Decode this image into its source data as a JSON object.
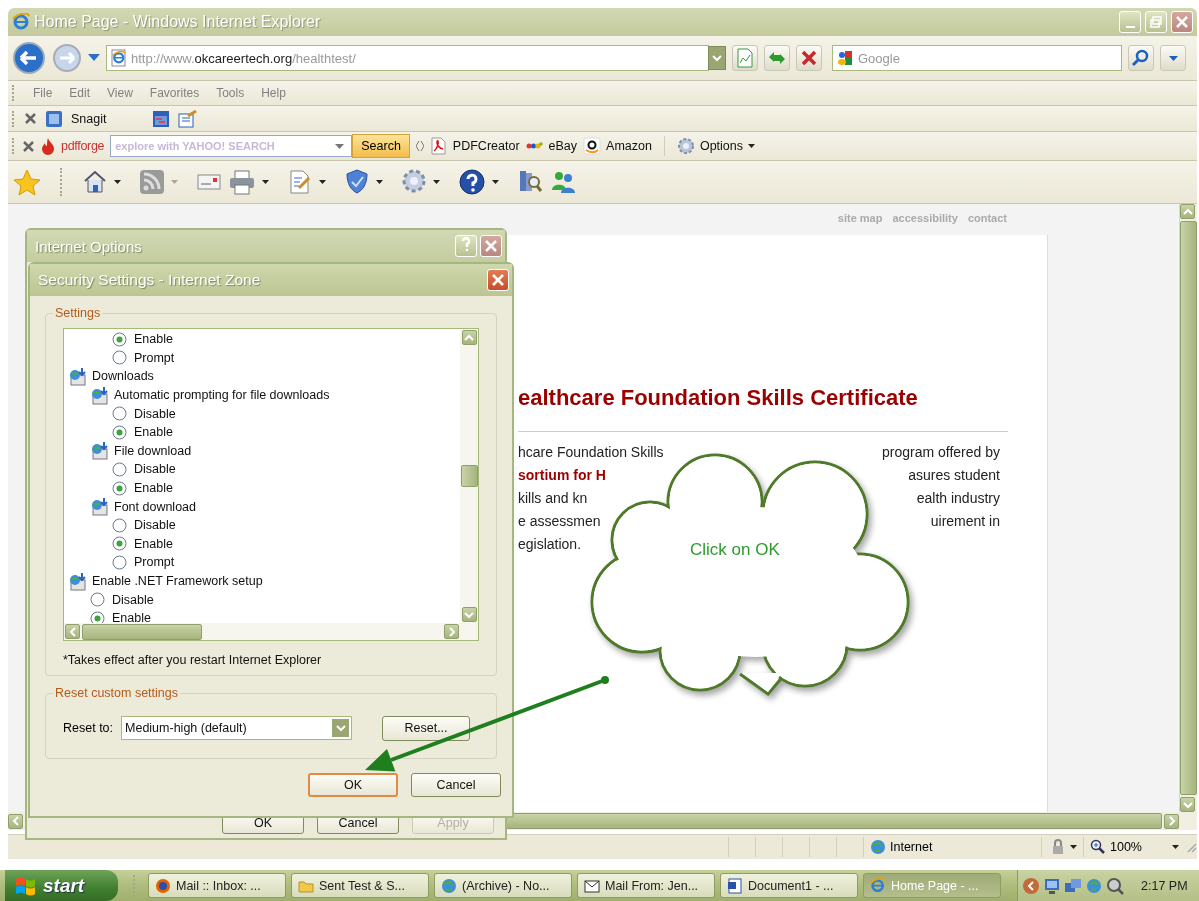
{
  "window": {
    "title": "Home Page - Windows Internet Explorer"
  },
  "address_bar": {
    "url": [
      "http://www.",
      "okcareertech.org",
      "/healthtest/"
    ],
    "search_placeholder": "Google"
  },
  "menu": [
    "File",
    "Edit",
    "View",
    "Favorites",
    "Tools",
    "Help"
  ],
  "snagit_toolbar": {
    "label": "Snagit"
  },
  "pdfforge_toolbar": {
    "logo": "pdfforge",
    "search_placeholder": "explore with YAHOO! SEARCH",
    "search_button": "Search",
    "links": [
      {
        "kind": "pdf",
        "label": "PDFCreator"
      },
      {
        "kind": "ebay",
        "label": "eBay"
      },
      {
        "kind": "amazon",
        "label": "Amazon"
      }
    ],
    "options": "Options"
  },
  "content": {
    "top_links": [
      "site map",
      "accessibility",
      "contact"
    ],
    "heading": "ealthcare Foundation Skills Certificate",
    "lines": [
      {
        "left": "hcare Foundation Skills",
        "right": "program offered by",
        "emphasis": false
      },
      {
        "left": "sortium for H",
        "right": "asures student",
        "emphasis": true
      },
      {
        "left": "kills and kn",
        "right": "ealth industry",
        "emphasis": false
      },
      {
        "left": "e assessmen",
        "right": "uirement in",
        "emphasis": false
      },
      {
        "left": "egislation.",
        "emphasis": false
      }
    ]
  },
  "callout": {
    "text": "Click on OK"
  },
  "internet_options": {
    "title": "Internet Options",
    "buttons": [
      {
        "label": "OK",
        "disabled": false
      },
      {
        "label": "Cancel",
        "disabled": false
      },
      {
        "label": "Apply",
        "disabled": true
      }
    ]
  },
  "security_dialog": {
    "title": "Security Settings - Internet Zone",
    "settings_label": "Settings",
    "tree": [
      {
        "kind": "group",
        "children": [
          {
            "kind": "group",
            "children": [
              {
                "kind": "radio",
                "label": "Enable",
                "selected": true
              },
              {
                "kind": "radio",
                "label": "Prompt",
                "selected": false
              }
            ]
          }
        ]
      },
      {
        "kind": "setting",
        "label": "Downloads",
        "children": [
          {
            "kind": "setting",
            "label": "Automatic prompting for file downloads",
            "children": [
              {
                "kind": "radio",
                "label": "Disable",
                "selected": false
              },
              {
                "kind": "radio",
                "label": "Enable",
                "selected": true
              }
            ]
          },
          {
            "kind": "setting",
            "label": "File download",
            "children": [
              {
                "kind": "radio",
                "label": "Disable",
                "selected": false
              },
              {
                "kind": "radio",
                "label": "Enable",
                "selected": true
              }
            ]
          },
          {
            "kind": "setting",
            "label": "Font download",
            "children": [
              {
                "kind": "radio",
                "label": "Disable",
                "selected": false
              },
              {
                "kind": "radio",
                "label": "Enable",
                "selected": true
              },
              {
                "kind": "radio",
                "label": "Prompt",
                "selected": false
              }
            ]
          }
        ]
      },
      {
        "kind": "setting",
        "label": "Enable .NET Framework setup",
        "children": [
          {
            "kind": "radio",
            "label": "Disable",
            "selected": false
          },
          {
            "kind": "radio",
            "label": "Enable",
            "selected": true
          }
        ]
      }
    ],
    "note": "*Takes effect after you restart Internet Explorer",
    "reset_group_label": "Reset custom settings",
    "reset_label": "Reset to:",
    "reset_value": "Medium-high (default)",
    "reset_button": "Reset...",
    "buttons": [
      {
        "label": "OK",
        "default": true
      },
      {
        "label": "Cancel",
        "default": false
      }
    ]
  },
  "status_bar": {
    "zone": "Internet",
    "zoom": "100%"
  },
  "taskbar": {
    "start": "start",
    "tasks": [
      {
        "kind": "firefox",
        "label": "Mail :: Inbox: ...",
        "selected": false
      },
      {
        "kind": "folder",
        "label": "Sent Test & S...",
        "selected": false
      },
      {
        "kind": "globe",
        "label": "(Archive) - No...",
        "selected": false
      },
      {
        "kind": "mail",
        "label": "Mail From: Jen...",
        "selected": false
      },
      {
        "kind": "document",
        "label": "Document1 - ...",
        "selected": false
      },
      {
        "kind": "ie",
        "label": "Home Page - ...",
        "selected": true
      }
    ],
    "clock": "2:17 PM"
  }
}
